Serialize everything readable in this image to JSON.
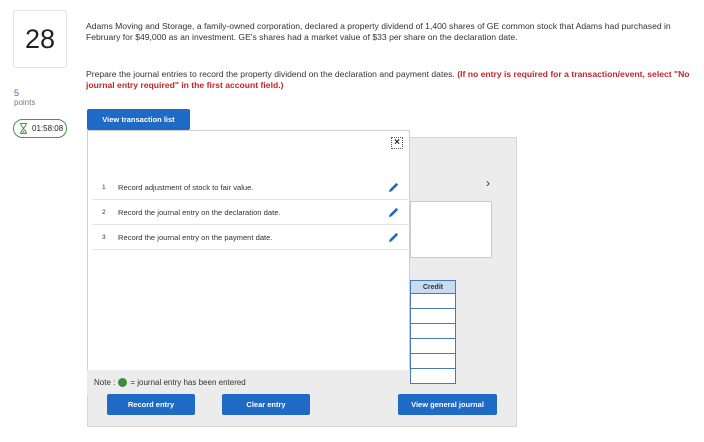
{
  "question": {
    "number": "28",
    "points_value": "5",
    "points_label": "points",
    "timer": "01:58:08",
    "text": "Adams Moving and Storage, a family-owned corporation, declared a property dividend of 1,400 shares of GE common stock that Adams had purchased in February for $49,000 as an investment. GE's shares had a market value of $33 per share on the declaration date.",
    "instruction": "Prepare the journal entries to record the property dividend on the declaration and payment dates.",
    "instruction_red": "(If no entry is required for a transaction/event, select \"No journal entry required\" in the first account field.)"
  },
  "buttons": {
    "view_transaction_list": "View transaction list",
    "record_entry": "Record entry",
    "clear_entry": "Clear entry",
    "view_general_journal": "View general journal",
    "close": "×"
  },
  "tasks": [
    {
      "num": "1",
      "label": "Record adjustment of stock to fair value."
    },
    {
      "num": "2",
      "label": "Record the journal entry on the declaration date."
    },
    {
      "num": "3",
      "label": "Record the journal entry on the payment date."
    }
  ],
  "note": {
    "prefix": "Note :",
    "suffix": "= journal entry has been entered"
  },
  "worksheet": {
    "credit_header": "Credit",
    "chevron": "›"
  },
  "colors": {
    "accent_blue": "#1e6ac4",
    "instruction_red": "#c0262d",
    "entered_green": "#3e8a3e"
  },
  "icons": {
    "task_edit": "pencil-icon",
    "timer": "hourglass-icon",
    "close": "close-icon",
    "next": "chevron-right-icon"
  }
}
